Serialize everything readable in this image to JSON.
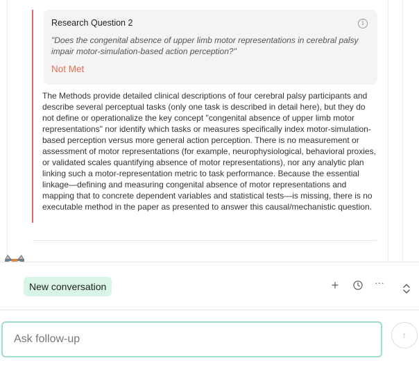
{
  "finding": {
    "question_title": "Research Question 2",
    "question_text": "\"Does the congenital absence of upper limb motor representations in cerebral palsy impair motor-simulation-based action perception?\"",
    "status": "Not Met",
    "status_color": "#e2704f",
    "border_color": "#e06b6b",
    "info_icon": "info-icon",
    "info_glyph": "i",
    "explanation": "The Methods provide detailed clinical descriptions of four cerebral palsy participants and describe several perceptual tasks (only one task is described in detail here), but they do not define or operationalize the key concept \"congenital absence of upper limb motor representations\" nor identify which tasks or measures specifically index motor-simulation-based perception versus more general action perception. There is no measurement or assessment of motor representations (for example, neurophysiological, behavioral proxies, or validated scales quantifying absence of motor representations), nor any analytic plan linking such a motor-representation metric to task performance. Because the essential linkage—defining and measuring congenital absence of motor representations and mapping that to concrete dependent variables and statistical tests—is missing, there is no executable method in the paper as presented to answer this causal/mechanistic question."
  },
  "conversation": {
    "chip_label": "New conversation",
    "chip_color": "#d9f5e7",
    "icons": {
      "new": "plus-icon",
      "history": "clock-icon",
      "more": "more-icon",
      "expand": "expand-icon",
      "mascot": "cat-mascot-icon"
    },
    "plus_glyph": "+",
    "more_glyph": "···"
  },
  "composer": {
    "placeholder": "Ask follow-up",
    "value": "",
    "send_glyph": "↑",
    "accent_color": "#9fe1c2"
  }
}
